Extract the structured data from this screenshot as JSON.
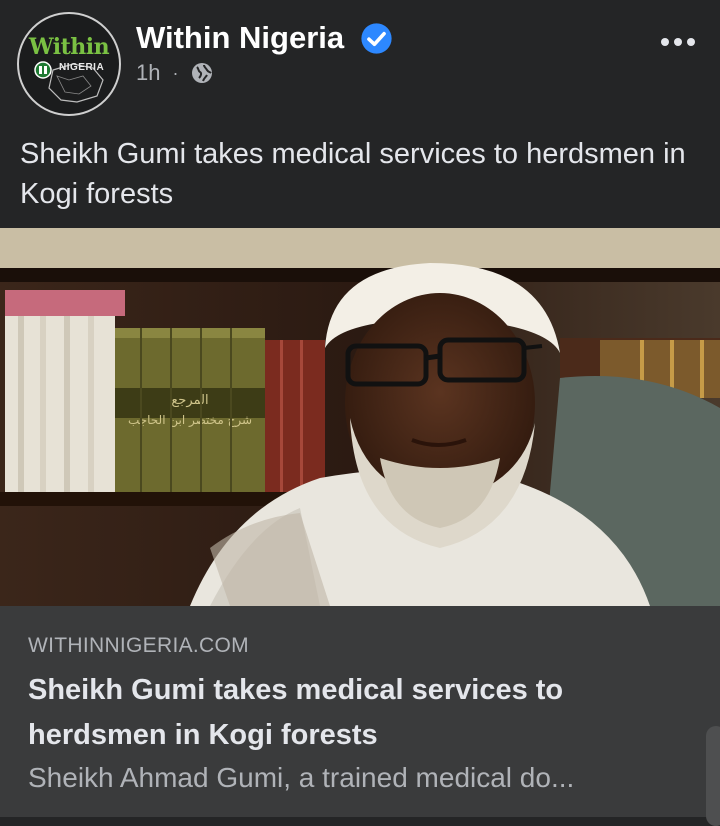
{
  "post": {
    "page_name": "Within Nigeria",
    "avatar_wordmark": "Within",
    "avatar_subword": "NIGERIA",
    "time": "1h",
    "dot": "·",
    "visibility_icon": "globe-icon",
    "verified_icon": "verified-badge-icon",
    "more_icon": "more-options-icon",
    "text": "Sheikh Gumi takes medical services to herdsmen in Kogi forests"
  },
  "photo": {
    "shelf_text_1": "المرجع",
    "shelf_text_2": "شرح مختصر ابن الحاجب"
  },
  "link_preview": {
    "domain": "WITHINNIGERIA.COM",
    "title": "Sheikh Gumi takes medical services to herdsmen in Kogi forests",
    "description": "Sheikh Ahmad Gumi, a trained medical do..."
  },
  "colors": {
    "background": "#242526",
    "card": "#3a3b3c",
    "accent_blue": "#2d88ff",
    "brand_green": "#7ac143"
  }
}
